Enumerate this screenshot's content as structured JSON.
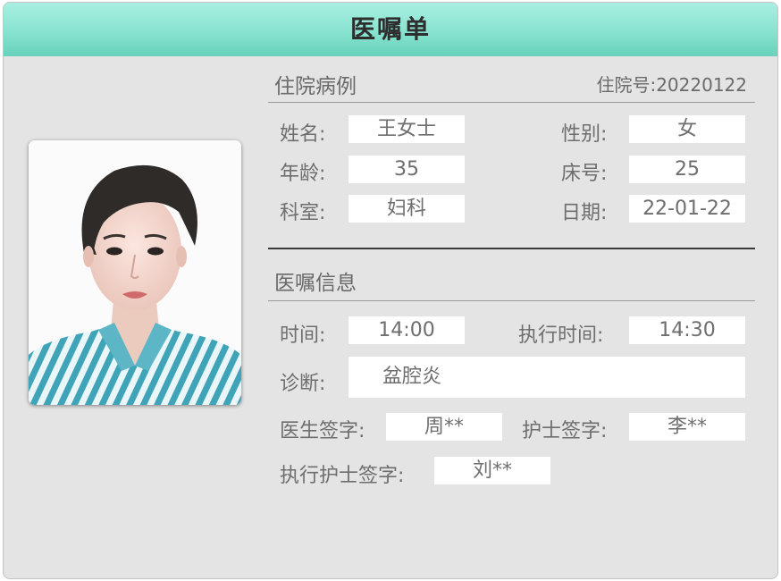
{
  "header": {
    "title": "医嘱单"
  },
  "case": {
    "section_title": "住院病例",
    "admission_label": "住院号:",
    "admission_no": "20220122",
    "fields": {
      "name": {
        "label": "姓名:",
        "value": "王女士"
      },
      "gender": {
        "label": "性别:",
        "value": "女"
      },
      "age": {
        "label": "年龄:",
        "value": "35"
      },
      "bed": {
        "label": "床号:",
        "value": "25"
      },
      "dept": {
        "label": "科室:",
        "value": "妇科"
      },
      "date": {
        "label": "日期:",
        "value": "22-01-22"
      }
    }
  },
  "order": {
    "section_title": "医嘱信息",
    "fields": {
      "time": {
        "label": "时间:",
        "value": "14:00"
      },
      "exec_time": {
        "label": "执行时间:",
        "value": "14:30"
      },
      "diagnosis": {
        "label": "诊断:",
        "value": "盆腔炎"
      },
      "doctor_sign": {
        "label": "医生签字:",
        "value": "周**"
      },
      "nurse_sign": {
        "label": "护士签字:",
        "value": "李**"
      },
      "exec_nurse_sign": {
        "label": "执行护士签字:",
        "value": "刘**"
      }
    }
  },
  "colors": {
    "header_top": "#a9efe2",
    "header_bottom": "#67d2bb",
    "panel_bg": "#e4e4e4"
  },
  "photo": {
    "icon": "patient-portrait"
  }
}
